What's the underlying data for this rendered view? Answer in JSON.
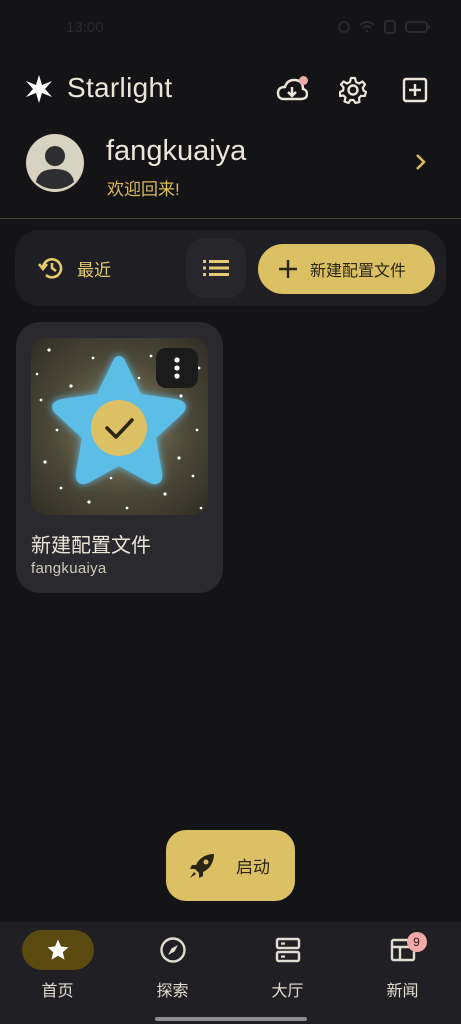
{
  "status_bar": {
    "time": "13:00"
  },
  "header": {
    "title": "Starlight",
    "icons": [
      "sparkle-logo-icon",
      "cloud-download-icon",
      "gear-icon",
      "add-box-icon"
    ]
  },
  "user": {
    "name": "fangkuaiya",
    "welcome": "欢迎回来!"
  },
  "toolbar": {
    "recent_label": "最近",
    "new_profile_label": "新建配置文件"
  },
  "profiles": [
    {
      "title": "新建配置文件",
      "author": "fangkuaiya",
      "selected": true
    }
  ],
  "fab": {
    "label": "启动"
  },
  "bottom_nav": {
    "items": [
      {
        "label": "首页",
        "icon": "star-icon",
        "active": true
      },
      {
        "label": "探索",
        "icon": "compass-icon",
        "active": false
      },
      {
        "label": "大厅",
        "icon": "server-icon",
        "active": false
      },
      {
        "label": "新闻",
        "icon": "news-icon",
        "active": false,
        "badge": "9"
      }
    ]
  },
  "colors": {
    "background": "#141316",
    "accent": "#dcc064",
    "surface": "#1f1e22",
    "card": "#2a292e",
    "star": "#5bbde6"
  }
}
